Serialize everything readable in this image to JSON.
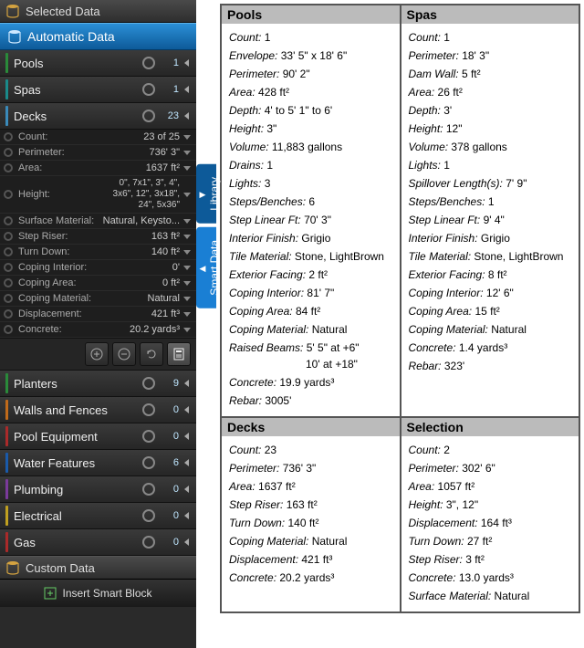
{
  "headers": {
    "selected": "Selected Data",
    "automatic": "Automatic Data",
    "custom": "Custom Data",
    "insert": "Insert Smart Block"
  },
  "tabs": {
    "library": "Library",
    "smart": "Smart Data"
  },
  "categories": [
    {
      "label": "Pools",
      "count": "1",
      "accent": "ac-green"
    },
    {
      "label": "Spas",
      "count": "1",
      "accent": "ac-teal"
    },
    {
      "label": "Decks",
      "count": "23",
      "accent": "ac-lightblue"
    },
    {
      "label": "Planters",
      "count": "9",
      "accent": "ac-green"
    },
    {
      "label": "Walls and Fences",
      "count": "0",
      "accent": "ac-orange"
    },
    {
      "label": "Pool Equipment",
      "count": "0",
      "accent": "ac-red"
    },
    {
      "label": "Water Features",
      "count": "6",
      "accent": "ac-blue"
    },
    {
      "label": "Plumbing",
      "count": "0",
      "accent": "ac-purple"
    },
    {
      "label": "Electrical",
      "count": "0",
      "accent": "ac-yellow"
    },
    {
      "label": "Gas",
      "count": "0",
      "accent": "ac-red"
    }
  ],
  "deckDetails": [
    {
      "label": "Count:",
      "value": "23 of 25"
    },
    {
      "label": "Perimeter:",
      "value": "736' 3\""
    },
    {
      "label": "Area:",
      "value": "1637 ft²"
    },
    {
      "label": "Height:",
      "value": "0\", 7x1\", 3\", 4\",",
      "value2": "3x6\", 12\", 3x18\",",
      "value3": "24\", 5x36\""
    },
    {
      "label": "Surface Material:",
      "value": "Natural, Keysto..."
    },
    {
      "label": "Step Riser:",
      "value": "163 ft²"
    },
    {
      "label": "Turn Down:",
      "value": "140 ft²"
    },
    {
      "label": "Coping Interior:",
      "value": "0'"
    },
    {
      "label": "Coping Area:",
      "value": "0 ft²"
    },
    {
      "label": "Coping Material:",
      "value": "Natural"
    },
    {
      "label": "Displacement:",
      "value": "421 ft³"
    },
    {
      "label": "Concrete:",
      "value": "20.2 yards³"
    }
  ],
  "panels": [
    {
      "title": "Pools",
      "props": [
        {
          "n": "Count:",
          "v": "1"
        },
        {
          "n": "Envelope:",
          "v": "33' 5\" x 18' 6\""
        },
        {
          "n": "Perimeter:",
          "v": "90' 2\""
        },
        {
          "n": "Area:",
          "v": "428 ft²"
        },
        {
          "n": "Depth:",
          "v": "4' to 5' 1\" to 6'"
        },
        {
          "n": "Height:",
          "v": "3\""
        },
        {
          "n": "Volume:",
          "v": "11,883 gallons"
        },
        {
          "n": "Drains:",
          "v": "1"
        },
        {
          "n": "Lights:",
          "v": "3"
        },
        {
          "n": "Steps/Benches:",
          "v": "6"
        },
        {
          "n": "Step Linear Ft:",
          "v": "70' 3\""
        },
        {
          "n": "Interior Finish:",
          "v": "Grigio"
        },
        {
          "n": "Tile Material:",
          "v": "Stone, LightBrown"
        },
        {
          "n": "Exterior Facing:",
          "v": "2 ft²"
        },
        {
          "n": "Coping Interior:",
          "v": "81' 7\""
        },
        {
          "n": "Coping Area:",
          "v": "84 ft²"
        },
        {
          "n": "Coping Material:",
          "v": "Natural"
        },
        {
          "n": "Raised Beams:",
          "v": "5' 5\" at +6\"",
          "sub": "10' at +18\""
        },
        {
          "n": "Concrete:",
          "v": "19.9 yards³"
        },
        {
          "n": "Rebar:",
          "v": "3005'"
        }
      ]
    },
    {
      "title": "Spas",
      "props": [
        {
          "n": "Count:",
          "v": "1"
        },
        {
          "n": "Perimeter:",
          "v": "18' 3\""
        },
        {
          "n": "Dam Wall:",
          "v": "5 ft²"
        },
        {
          "n": "Area:",
          "v": "26 ft²"
        },
        {
          "n": "Depth:",
          "v": "3'"
        },
        {
          "n": "Height:",
          "v": "12\""
        },
        {
          "n": "Volume:",
          "v": "378 gallons"
        },
        {
          "n": "Lights:",
          "v": "1"
        },
        {
          "n": "Spillover Length(s):",
          "v": "7' 9\""
        },
        {
          "n": "Steps/Benches:",
          "v": "1"
        },
        {
          "n": "Step Linear Ft:",
          "v": "9' 4\""
        },
        {
          "n": "Interior Finish:",
          "v": "Grigio"
        },
        {
          "n": "Tile Material:",
          "v": "Stone, LightBrown"
        },
        {
          "n": "Exterior Facing:",
          "v": "8 ft²"
        },
        {
          "n": "Coping Interior:",
          "v": "12' 6\""
        },
        {
          "n": "Coping Area:",
          "v": "15 ft²"
        },
        {
          "n": "Coping Material:",
          "v": "Natural"
        },
        {
          "n": "Concrete:",
          "v": "1.4 yards³"
        },
        {
          "n": "Rebar:",
          "v": "323'"
        }
      ]
    },
    {
      "title": "Decks",
      "props": [
        {
          "n": "Count:",
          "v": "23"
        },
        {
          "n": "Perimeter:",
          "v": "736' 3\""
        },
        {
          "n": "Area:",
          "v": "1637 ft²"
        },
        {
          "n": "Step Riser:",
          "v": "163 ft²"
        },
        {
          "n": "Turn Down:",
          "v": "140 ft²"
        },
        {
          "n": "Coping Material:",
          "v": "Natural"
        },
        {
          "n": "Displacement:",
          "v": "421 ft³"
        },
        {
          "n": "Concrete:",
          "v": "20.2 yards³"
        }
      ]
    },
    {
      "title": "Selection",
      "props": [
        {
          "n": "Count:",
          "v": "2"
        },
        {
          "n": "Perimeter:",
          "v": "302' 6\""
        },
        {
          "n": "Area:",
          "v": "1057 ft²"
        },
        {
          "n": "Height:",
          "v": "3\", 12\""
        },
        {
          "n": "Displacement:",
          "v": "164 ft³"
        },
        {
          "n": "Turn Down:",
          "v": "27 ft²"
        },
        {
          "n": "Step Riser:",
          "v": "3 ft²"
        },
        {
          "n": "Concrete:",
          "v": "13.0 yards³"
        },
        {
          "n": "Surface Material:",
          "v": "Natural"
        }
      ]
    }
  ]
}
